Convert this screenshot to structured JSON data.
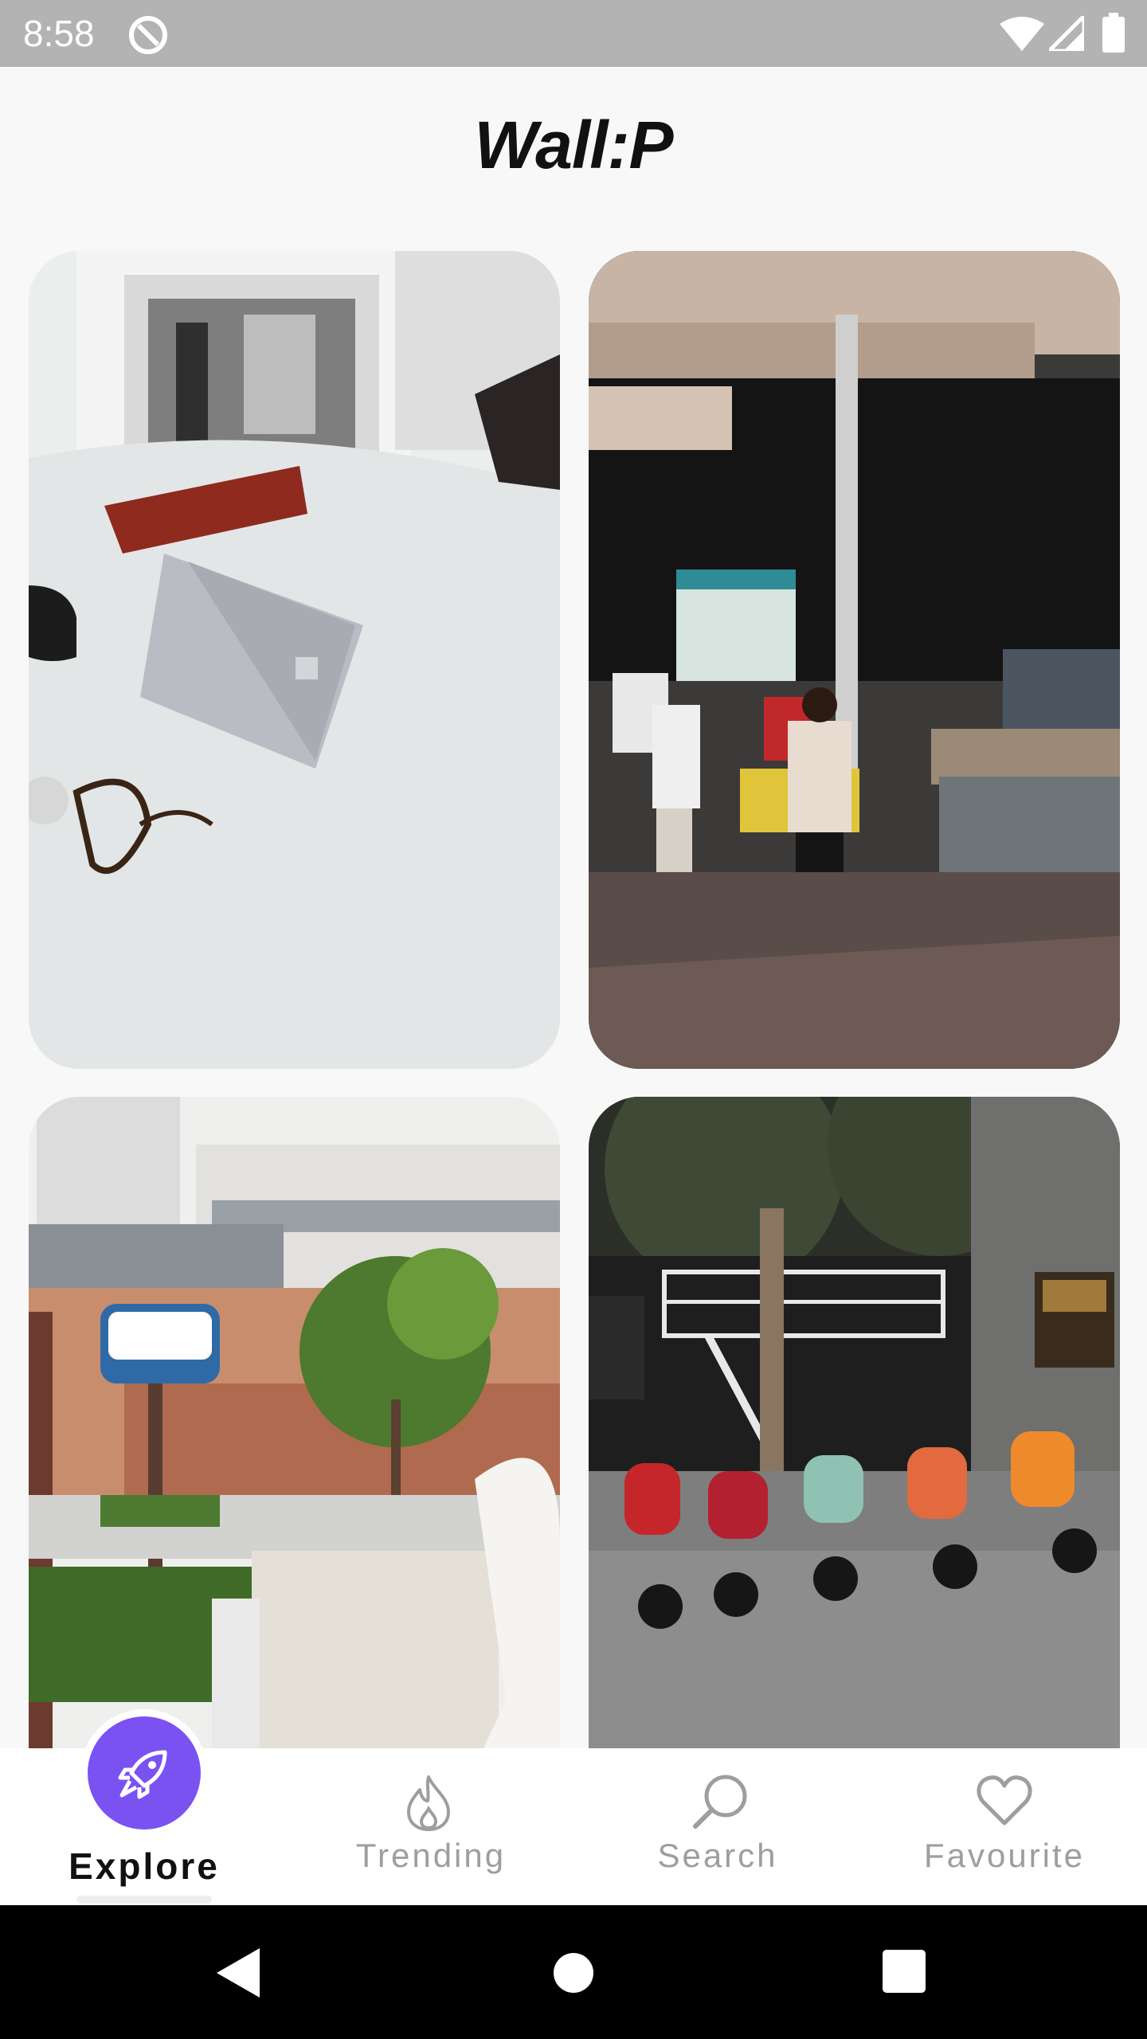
{
  "status_bar": {
    "time": "8:58",
    "icons": [
      "at-sign-icon",
      "wifi-icon",
      "cell-signal-icon",
      "battery-icon"
    ]
  },
  "app": {
    "title": "Wall:P"
  },
  "wallpapers": [
    {
      "name": "desk-laptop-photo"
    },
    {
      "name": "street-food-stall-photo"
    },
    {
      "name": "street-sign-buildings-photo"
    },
    {
      "name": "scooters-row-photo"
    }
  ],
  "bottom_nav": {
    "active": "Explore",
    "accent_color": "#7b52f2",
    "items": [
      {
        "label": "Explore",
        "icon": "rocket-icon"
      },
      {
        "label": "Trending",
        "icon": "flame-icon"
      },
      {
        "label": "Search",
        "icon": "search-icon"
      },
      {
        "label": "Favourite",
        "icon": "heart-icon"
      }
    ]
  },
  "system_nav": {
    "buttons": [
      "back-icon",
      "home-icon",
      "recents-icon"
    ]
  }
}
